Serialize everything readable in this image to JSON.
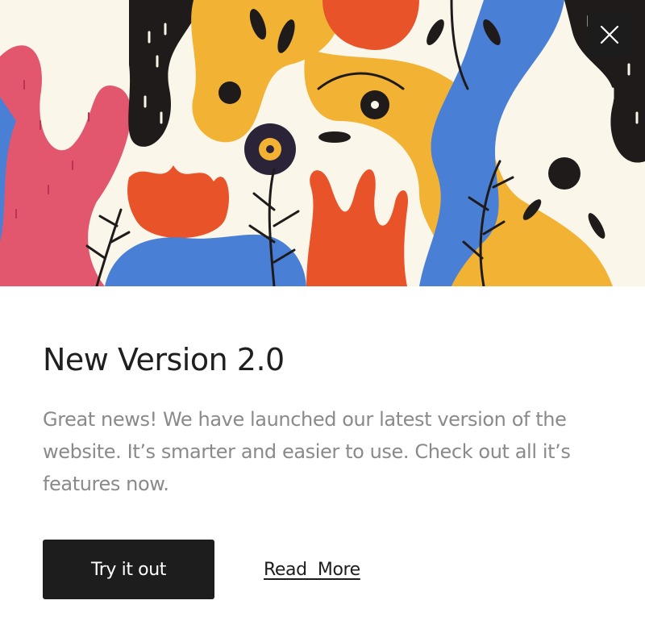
{
  "hero": {
    "icon": "close-icon",
    "close_label": "Close"
  },
  "content": {
    "title": "New Version 2.0",
    "description": "Great news! We have launched our latest version of the website.  It’s smarter and easier to use. Check out all it’s features now."
  },
  "actions": {
    "primary_label": "Try it out",
    "link_label": "Read  More"
  },
  "colors": {
    "primary": "#1d1d1d",
    "text_muted": "#8a8a8a",
    "hero_bg": "#fbf6ea"
  }
}
